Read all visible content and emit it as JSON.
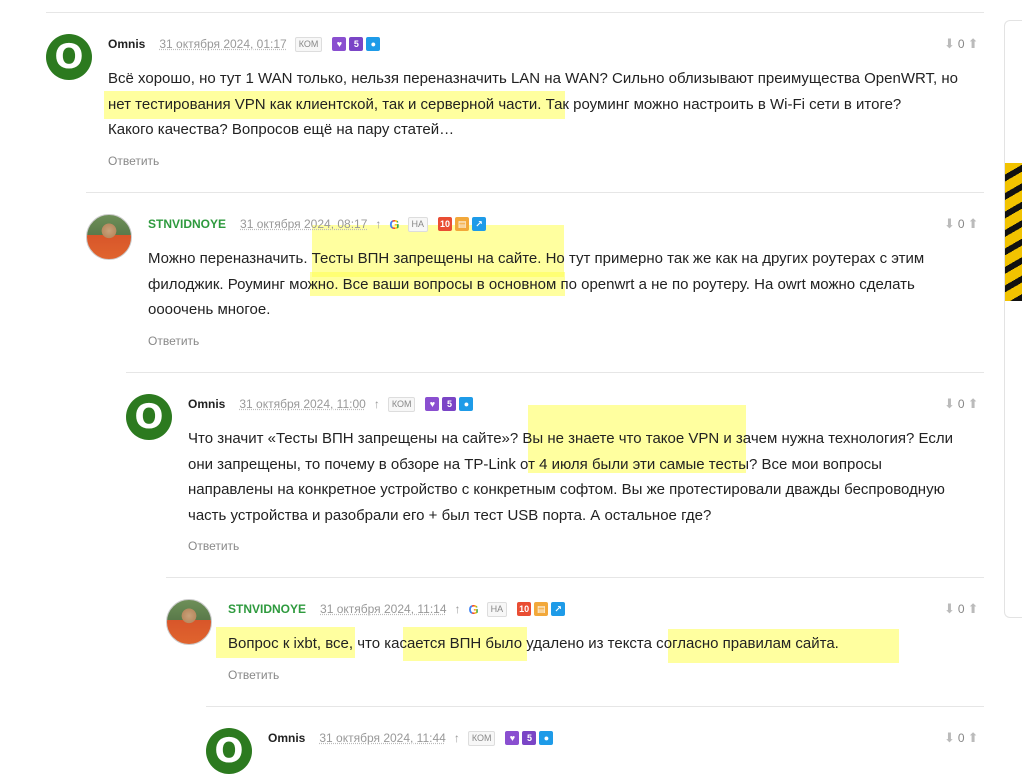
{
  "reply_label": "Ответить",
  "comments": [
    {
      "user": "Omnis",
      "date": "31 октября 2024, 01:17",
      "tag": "КОМ",
      "badge_num": "5",
      "votes": "0",
      "lines": [
        "Всё хорошо, но тут 1 WAN только, нельзя переназначить LAN на WAN? Сильно облизывают преимущества OpenWRT, но",
        "нет тестирования VPN как клиентской, так и серверной части. Так роуминг можно настроить в Wi-Fi сети в итоге?",
        "Какого качества? Вопросов ещё на пару статей…"
      ]
    },
    {
      "user": "STNVIDNOYE",
      "date": "31 октября 2024, 08:17",
      "tag": "НА",
      "badge_num": "10",
      "votes": "0",
      "lines": [
        "Можно переназначить. Тесты ВПН запрещены на сайте. Но тут примерно так же как на других роутерах с этим",
        "филоджик. Роуминг можно. Все ваши вопросы в основном по openwrt а не по роутеру. На owrt можно сделать",
        "оооочень многое."
      ]
    },
    {
      "user": "Omnis",
      "date": "31 октября 2024, 11:00",
      "tag": "КОМ",
      "badge_num": "5",
      "votes": "0",
      "lines": [
        "Что значит «Тесты ВПН запрещены на сайте»? Вы не знаете что такое VPN и зачем нужна технология? Если",
        "они запрещены, то почему в обзоре на TP-Link от 4 июля были эти самые тесты? Все мои вопросы",
        "направлены на конкретное устройство с конкретным софтом. Вы же протестировали дважды беспроводную",
        "часть устройства и разобрали его + был тест USB порта. А остальное где?"
      ]
    },
    {
      "user": "STNVIDNOYE",
      "date": "31 октября 2024, 11:14",
      "tag": "НА",
      "badge_num": "10",
      "votes": "0",
      "lines": [
        "Вопрос к ixbt, все, что касается ВПН было удалено из текста согласно правилам сайта."
      ]
    },
    {
      "user": "Omnis",
      "date": "31 октября 2024, 11:44",
      "tag": "КОМ",
      "badge_num": "5",
      "votes": "0",
      "lines": []
    }
  ],
  "colors": {
    "highlight": "#ffff50",
    "avatar_green": "#2c7a1f",
    "username_green": "#2e9a3e",
    "badge_purple": "#7a45c6",
    "badge_blue": "#1e9be8",
    "badge_red": "#e94d33"
  },
  "icons": [
    "vote-down-icon",
    "vote-up-icon",
    "heart-icon",
    "chat-icon",
    "google-icon",
    "book-icon",
    "chart-icon",
    "arrow-up-icon"
  ]
}
